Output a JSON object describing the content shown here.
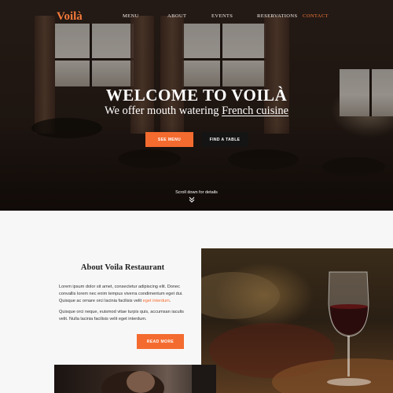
{
  "header": {
    "logo": "Voilà",
    "nav": [
      {
        "label": "MENU",
        "active": false
      },
      {
        "label": "ABOUT",
        "active": false
      },
      {
        "label": "EVENTS",
        "active": false
      },
      {
        "label": "RESERVATIONS",
        "active": false
      },
      {
        "label": "CONTACT",
        "active": true
      }
    ]
  },
  "hero": {
    "title": "WELCOME TO VOILÀ",
    "subtitle_start": "We offer mouth watering ",
    "subtitle_emphasis": "French cuisine",
    "see_menu_label": "SEE MENU",
    "find_table_label": "FIND A TABLE",
    "scroll_hint": "Scroll down for details",
    "scroll_icon": "chevron-double-down-icon"
  },
  "about": {
    "title": "About Voila Restaurant",
    "p1_start": "Lorem ipsum dolor sit amet, consectetur adipiscing elit. Donec convallis lorem nec enim tempus viverra condimentum eget dui. Quisque ac ornare orci lacinia facilisis velit ",
    "p1_highlight": "eget interdum",
    "p1_end": ".",
    "p2": "Quisque orci neque, euismod vitae turpis quis, accumsan iaculis velit. Nulla lacinia facilisis velit eget interdum.",
    "read_more_label": "READ MORE"
  },
  "colors": {
    "accent": "#f46b2f",
    "dark_button": "#141414",
    "section_bg": "#f7f7f7"
  }
}
